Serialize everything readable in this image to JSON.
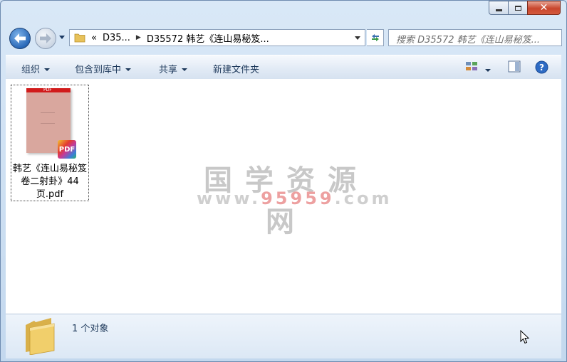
{
  "nav": {
    "breadcrumb": [
      {
        "label": "«"
      },
      {
        "label": "D35..."
      },
      {
        "label": "D35572 韩艺《连山易秘笈..."
      }
    ],
    "search_placeholder": "搜索 D35572 韩艺《连山易秘笈..."
  },
  "toolbar": {
    "organize": "组织",
    "include_library": "包含到库中",
    "share": "共享",
    "new_folder": "新建文件夹"
  },
  "files": [
    {
      "name": "韩艺《连山易秘笈卷二射卦》44页.pdf",
      "badge": "PDF",
      "thumb_label": "PDF"
    }
  ],
  "watermark": {
    "title": "国学资源网",
    "url_prefix": "www.",
    "url_number": "95959",
    "url_suffix": ".com"
  },
  "status": {
    "count_text": "1 个对象"
  },
  "colors": {
    "accent": "#2a69b8",
    "close": "#c8452c",
    "pdf_red": "#d11b1b"
  }
}
